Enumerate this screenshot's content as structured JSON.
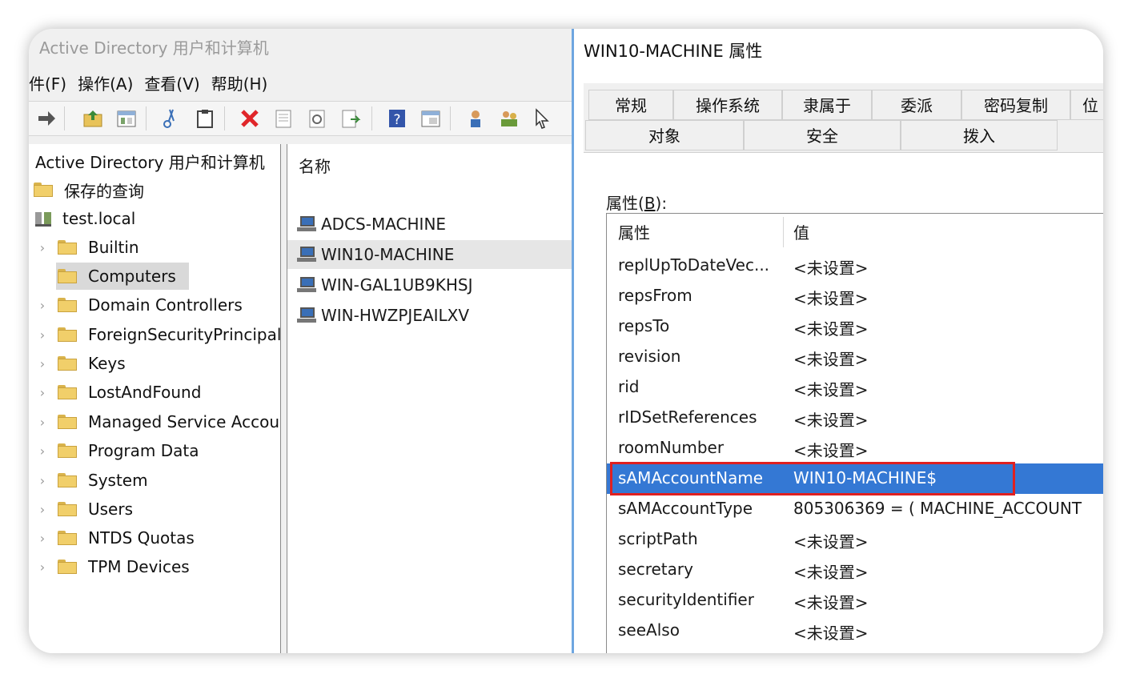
{
  "aduc": {
    "title": "Active Directory 用户和计算机",
    "menu": [
      "件(F)",
      "操作(A)",
      "查看(V)",
      "帮助(H)"
    ],
    "toolbar_icons": [
      "forward-arrow-icon",
      "up-folder-icon",
      "properties-icon",
      "cut-icon",
      "clipboard-icon",
      "delete-icon",
      "export-icon",
      "refresh-icon",
      "export-list-icon",
      "help-icon",
      "console-icon",
      "users-icon",
      "group-icon",
      "filter-icon"
    ],
    "tree": {
      "root": "Active Directory 用户和计算机",
      "saved_queries": "保存的查询",
      "domain": "test.local",
      "items": [
        "Builtin",
        "Computers",
        "Domain Controllers",
        "ForeignSecurityPrincipals",
        "Keys",
        "LostAndFound",
        "Managed Service Accounts",
        "Program Data",
        "System",
        "Users",
        "NTDS Quotas",
        "TPM Devices"
      ],
      "selected": "Computers"
    },
    "list": {
      "header": "名称",
      "items": [
        "ADCS-MACHINE",
        "WIN10-MACHINE",
        "WIN-GAL1UB9KHSJ",
        "WIN-HWZPJEAILXV"
      ],
      "selected": "WIN10-MACHINE"
    }
  },
  "dialog": {
    "title": "WIN10-MACHINE 属性",
    "tabs_row1": [
      "常规",
      "操作系统",
      "隶属于",
      "委派",
      "密码复制",
      "位"
    ],
    "tabs_row2": [
      "对象",
      "安全",
      "拨入"
    ],
    "attributes_label_prefix": "属性(",
    "attributes_label_key": "B",
    "attributes_label_suffix": "):",
    "columns": [
      "属性",
      "值"
    ],
    "rows": [
      {
        "name": "replUpToDateVec...",
        "value": "<未设置>"
      },
      {
        "name": "repsFrom",
        "value": "<未设置>"
      },
      {
        "name": "repsTo",
        "value": "<未设置>"
      },
      {
        "name": "revision",
        "value": "<未设置>"
      },
      {
        "name": "rid",
        "value": "<未设置>"
      },
      {
        "name": "rIDSetReferences",
        "value": "<未设置>"
      },
      {
        "name": "roomNumber",
        "value": "<未设置>"
      },
      {
        "name": "sAMAccountName",
        "value": "WIN10-MACHINE$"
      },
      {
        "name": "sAMAccountType",
        "value": "805306369 = ( MACHINE_ACCOUNT"
      },
      {
        "name": "scriptPath",
        "value": "<未设置>"
      },
      {
        "name": "secretary",
        "value": "<未设置>"
      },
      {
        "name": "securityIdentifier",
        "value": "<未设置>"
      },
      {
        "name": "seeAlso",
        "value": "<未设置>"
      }
    ],
    "selected_row": "sAMAccountName",
    "colors": {
      "selection": "#3478d4",
      "highlight_border": "#e02020"
    }
  }
}
